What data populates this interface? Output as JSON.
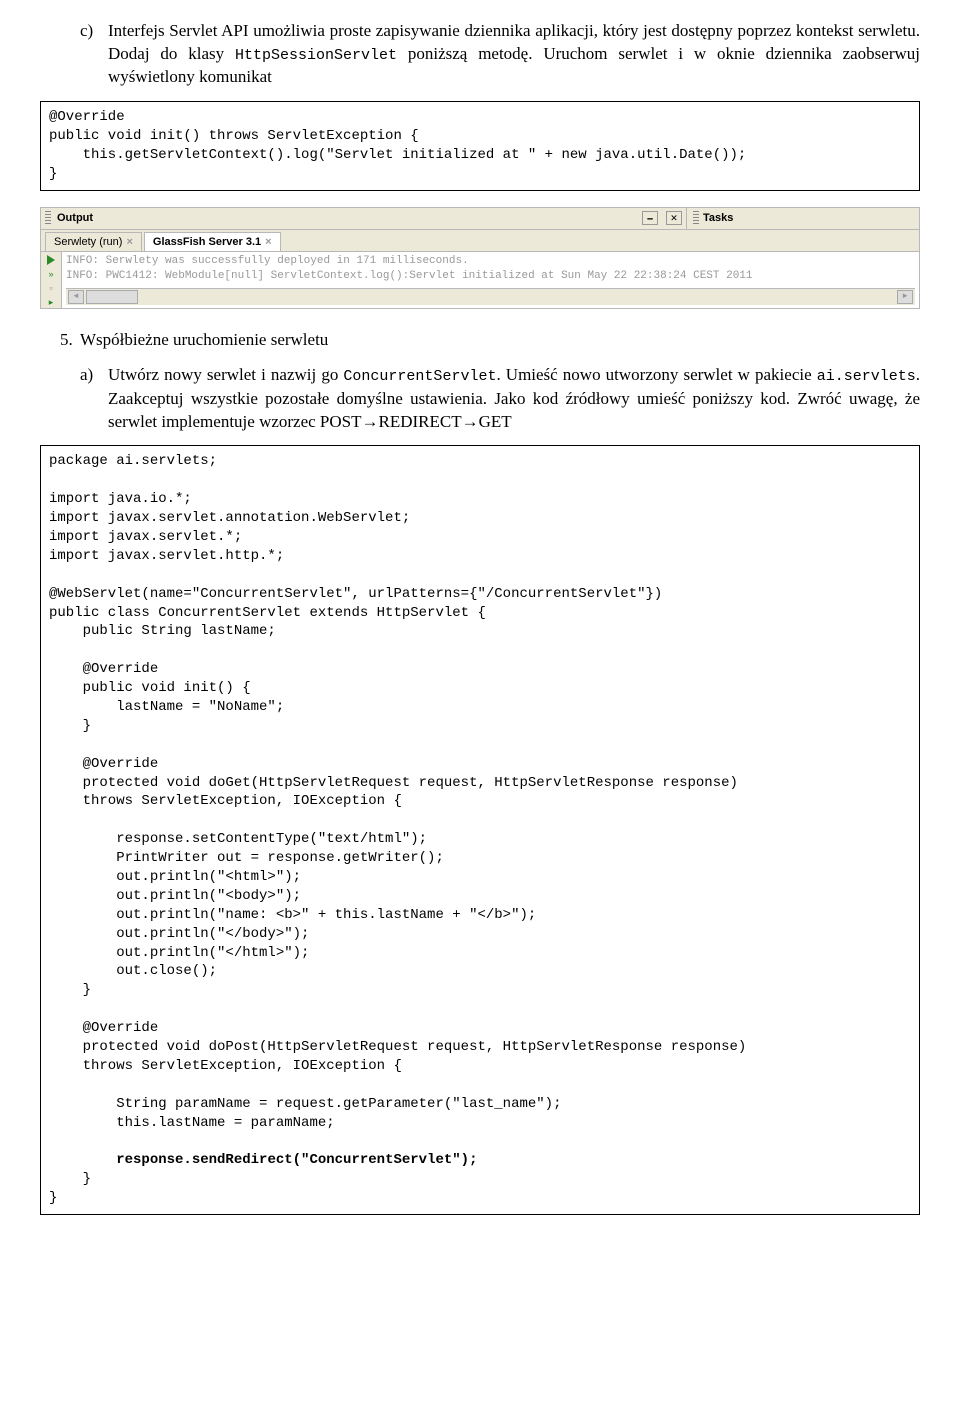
{
  "section_c": {
    "letter": "c)",
    "text_parts": [
      "Interfejs Servlet API umożliwia proste zapisywanie dziennika aplikacji, który jest dostępny poprzez kontekst serwletu. Dodaj do klasy ",
      "HttpSessionServlet",
      " poniższą metodę. Uruchom serwlet i w oknie dziennika zaobserwuj wyświetlony komunikat"
    ]
  },
  "code1": "@Override\npublic void init() throws ServletException {\n    this.getServletContext().log(\"Servlet initialized at \" + new java.util.Date());\n}",
  "ide": {
    "output_label": "Output",
    "tasks_label": "Tasks",
    "tab1": "Serwlety (run)",
    "tab2": "GlassFish Server 3.1",
    "log1": "INFO: Serwlety was successfully deployed in 171 milliseconds.",
    "log2": "INFO: PWC1412: WebModule[null] ServletContext.log():Servlet initialized at Sun May 22 22:38:24 CEST 2011"
  },
  "section_5": {
    "num": "5.",
    "title": "Współbieżne uruchomienie serwletu"
  },
  "section_a": {
    "letter": "a)",
    "text_parts": [
      "Utwórz nowy serwlet i nazwij go ",
      "ConcurrentServlet",
      ". Umieść nowo utworzony serwlet w pakiecie ",
      "ai.servlets",
      ". Zaakceptuj wszystkie pozostałe domyślne ustawienia. Jako kod źródłowy umieść poniższy kod. Zwróć uwagę, że serwlet implementuje wzorzec POST→REDIRECT→GET"
    ]
  },
  "code2_pre": "package ai.servlets;\n\nimport java.io.*;\nimport javax.servlet.annotation.WebServlet;\nimport javax.servlet.*;\nimport javax.servlet.http.*;\n\n@WebServlet(name=\"ConcurrentServlet\", urlPatterns={\"/ConcurrentServlet\"})\npublic class ConcurrentServlet extends HttpServlet {\n    public String lastName;\n\n    @Override\n    public void init() {\n        lastName = \"NoName\";\n    }\n\n    @Override\n    protected void doGet(HttpServletRequest request, HttpServletResponse response)\n    throws ServletException, IOException {\n\n        response.setContentType(\"text/html\");\n        PrintWriter out = response.getWriter();\n        out.println(\"<html>\");\n        out.println(\"<body>\");\n        out.println(\"name: <b>\" + this.lastName + \"</b>\");\n        out.println(\"</body>\");\n        out.println(\"</html>\");\n        out.close();\n    }\n\n    @Override\n    protected void doPost(HttpServletRequest request, HttpServletResponse response)\n    throws ServletException, IOException {\n\n        String paramName = request.getParameter(\"last_name\");\n        this.lastName = paramName;\n\n        ",
  "code2_bold": "response.sendRedirect(\"ConcurrentServlet\");",
  "code2_post": "\n    }\n}"
}
